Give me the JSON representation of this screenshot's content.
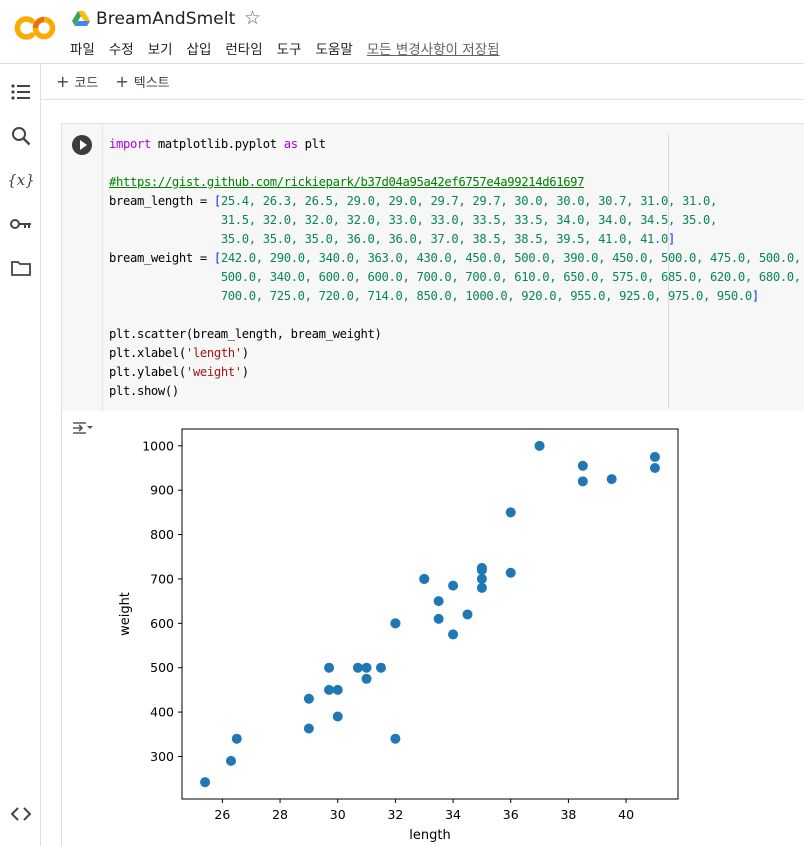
{
  "app": {
    "title": "BreamAndSmelt",
    "menu": [
      "파일",
      "수정",
      "보기",
      "삽입",
      "런타임",
      "도구",
      "도움말"
    ],
    "saved_status": "모든 변경사항이 저장됨",
    "logo_text": "CO",
    "colors": {
      "logo_orange": "#f9ab00",
      "logo_dark": "#e8710a",
      "accent": "#1f77b4"
    }
  },
  "toolbar": {
    "add_code": "코드",
    "add_text": "텍스트"
  },
  "leftrail": {
    "icons": [
      "table-of-contents-icon",
      "search-icon",
      "variables-icon",
      "key-icon",
      "folder-icon",
      "code-snippets-icon"
    ],
    "variables_label": "{x}"
  },
  "cell": {
    "code": [
      [
        {
          "t": "import",
          "c": "kw"
        },
        {
          "t": " matplotlib.pyplot ",
          "c": "fn"
        },
        {
          "t": "as",
          "c": "kw"
        },
        {
          "t": " plt",
          "c": "fn"
        }
      ],
      [],
      [
        {
          "t": "#https://gist.github.com/rickiepark/b37d04a95a42ef6757e4a99214d61697",
          "c": "url"
        }
      ],
      [
        {
          "t": "bream_length = ",
          "c": "fn"
        },
        {
          "t": "[",
          "c": "br"
        },
        {
          "t": "25.4, 26.3, 26.5, 29.0, 29.0, 29.7, 29.7, 30.0, 30.0, 30.7, 31.0, 31.0,",
          "c": "num"
        }
      ],
      [
        {
          "t": "                ",
          "c": "fn"
        },
        {
          "t": "31.5, 32.0, 32.0, 32.0, 33.0, 33.0, 33.5, 33.5, 34.0, 34.0, 34.5, 35.0,",
          "c": "num"
        }
      ],
      [
        {
          "t": "                ",
          "c": "fn"
        },
        {
          "t": "35.0, 35.0, 35.0, 36.0, 36.0, 37.0, 38.5, 38.5, 39.5, 41.0, 41.0",
          "c": "num"
        },
        {
          "t": "]",
          "c": "br"
        }
      ],
      [
        {
          "t": "bream_weight = ",
          "c": "fn"
        },
        {
          "t": "[",
          "c": "br"
        },
        {
          "t": "242.0, 290.0, 340.0, 363.0, 430.0, 450.0, 500.0, 390.0, 450.0, 500.0, 475.0, 500.0,",
          "c": "num"
        }
      ],
      [
        {
          "t": "                ",
          "c": "fn"
        },
        {
          "t": "500.0, 340.0, 600.0, 600.0, 700.0, 700.0, 610.0, 650.0, 575.0, 685.0, 620.0, 680.0,",
          "c": "num"
        }
      ],
      [
        {
          "t": "                ",
          "c": "fn"
        },
        {
          "t": "700.0, 725.0, 720.0, 714.0, 850.0, 1000.0, 920.0, 955.0, 925.0, 975.0, 950.0",
          "c": "num"
        },
        {
          "t": "]",
          "c": "br"
        }
      ],
      [],
      [
        {
          "t": "plt.scatter(bream_length, bream_weight)",
          "c": "fn"
        }
      ],
      [
        {
          "t": "plt.xlabel(",
          "c": "fn"
        },
        {
          "t": "'length'",
          "c": "str"
        },
        {
          "t": ")",
          "c": "fn"
        }
      ],
      [
        {
          "t": "plt.ylabel(",
          "c": "fn"
        },
        {
          "t": "'weight'",
          "c": "str"
        },
        {
          "t": ")",
          "c": "fn"
        }
      ],
      [
        {
          "t": "plt.show()",
          "c": "fn"
        }
      ]
    ]
  },
  "chart_data": {
    "type": "scatter",
    "x": [
      25.4,
      26.3,
      26.5,
      29.0,
      29.0,
      29.7,
      29.7,
      30.0,
      30.0,
      30.7,
      31.0,
      31.0,
      31.5,
      32.0,
      32.0,
      32.0,
      33.0,
      33.0,
      33.5,
      33.5,
      34.0,
      34.0,
      34.5,
      35.0,
      35.0,
      35.0,
      35.0,
      36.0,
      36.0,
      37.0,
      38.5,
      38.5,
      39.5,
      41.0,
      41.0
    ],
    "y": [
      242.0,
      290.0,
      340.0,
      363.0,
      430.0,
      450.0,
      500.0,
      390.0,
      450.0,
      500.0,
      475.0,
      500.0,
      500.0,
      340.0,
      600.0,
      600.0,
      700.0,
      700.0,
      610.0,
      650.0,
      575.0,
      685.0,
      620.0,
      680.0,
      700.0,
      725.0,
      720.0,
      714.0,
      850.0,
      1000.0,
      920.0,
      955.0,
      925.0,
      975.0,
      950.0
    ],
    "xlabel": "length",
    "ylabel": "weight",
    "xlim": [
      24.6,
      41.8
    ],
    "ylim": [
      204.1,
      1037.9
    ],
    "xticks": [
      26,
      28,
      30,
      32,
      34,
      36,
      38,
      40
    ],
    "yticks": [
      300,
      400,
      500,
      600,
      700,
      800,
      900,
      1000
    ],
    "color": "#1f77b4",
    "grid": false
  }
}
